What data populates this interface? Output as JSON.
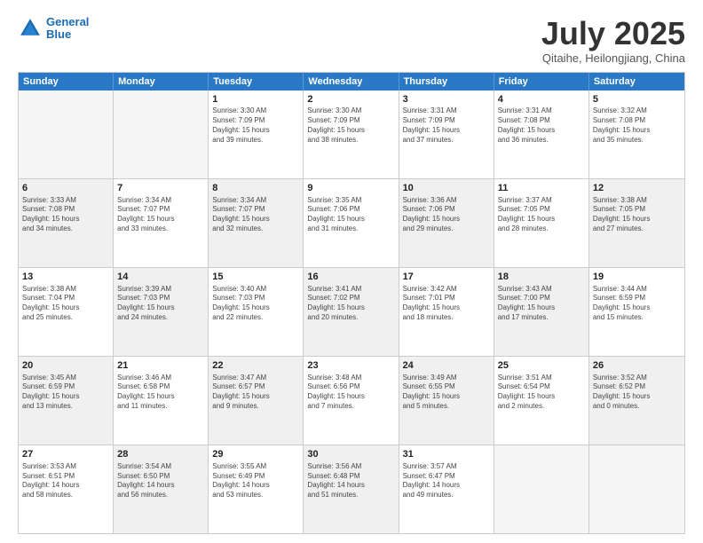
{
  "header": {
    "logo_line1": "General",
    "logo_line2": "Blue",
    "month": "July 2025",
    "location": "Qitaihe, Heilongjiang, China"
  },
  "weekdays": [
    "Sunday",
    "Monday",
    "Tuesday",
    "Wednesday",
    "Thursday",
    "Friday",
    "Saturday"
  ],
  "rows": [
    [
      {
        "day": "",
        "info": "",
        "empty": true
      },
      {
        "day": "",
        "info": "",
        "empty": true
      },
      {
        "day": "1",
        "info": "Sunrise: 3:30 AM\nSunset: 7:09 PM\nDaylight: 15 hours\nand 39 minutes."
      },
      {
        "day": "2",
        "info": "Sunrise: 3:30 AM\nSunset: 7:09 PM\nDaylight: 15 hours\nand 38 minutes."
      },
      {
        "day": "3",
        "info": "Sunrise: 3:31 AM\nSunset: 7:09 PM\nDaylight: 15 hours\nand 37 minutes."
      },
      {
        "day": "4",
        "info": "Sunrise: 3:31 AM\nSunset: 7:08 PM\nDaylight: 15 hours\nand 36 minutes."
      },
      {
        "day": "5",
        "info": "Sunrise: 3:32 AM\nSunset: 7:08 PM\nDaylight: 15 hours\nand 35 minutes."
      }
    ],
    [
      {
        "day": "6",
        "info": "Sunrise: 3:33 AM\nSunset: 7:08 PM\nDaylight: 15 hours\nand 34 minutes.",
        "shaded": true
      },
      {
        "day": "7",
        "info": "Sunrise: 3:34 AM\nSunset: 7:07 PM\nDaylight: 15 hours\nand 33 minutes."
      },
      {
        "day": "8",
        "info": "Sunrise: 3:34 AM\nSunset: 7:07 PM\nDaylight: 15 hours\nand 32 minutes.",
        "shaded": true
      },
      {
        "day": "9",
        "info": "Sunrise: 3:35 AM\nSunset: 7:06 PM\nDaylight: 15 hours\nand 31 minutes."
      },
      {
        "day": "10",
        "info": "Sunrise: 3:36 AM\nSunset: 7:06 PM\nDaylight: 15 hours\nand 29 minutes.",
        "shaded": true
      },
      {
        "day": "11",
        "info": "Sunrise: 3:37 AM\nSunset: 7:05 PM\nDaylight: 15 hours\nand 28 minutes."
      },
      {
        "day": "12",
        "info": "Sunrise: 3:38 AM\nSunset: 7:05 PM\nDaylight: 15 hours\nand 27 minutes.",
        "shaded": true
      }
    ],
    [
      {
        "day": "13",
        "info": "Sunrise: 3:38 AM\nSunset: 7:04 PM\nDaylight: 15 hours\nand 25 minutes."
      },
      {
        "day": "14",
        "info": "Sunrise: 3:39 AM\nSunset: 7:03 PM\nDaylight: 15 hours\nand 24 minutes.",
        "shaded": true
      },
      {
        "day": "15",
        "info": "Sunrise: 3:40 AM\nSunset: 7:03 PM\nDaylight: 15 hours\nand 22 minutes."
      },
      {
        "day": "16",
        "info": "Sunrise: 3:41 AM\nSunset: 7:02 PM\nDaylight: 15 hours\nand 20 minutes.",
        "shaded": true
      },
      {
        "day": "17",
        "info": "Sunrise: 3:42 AM\nSunset: 7:01 PM\nDaylight: 15 hours\nand 18 minutes."
      },
      {
        "day": "18",
        "info": "Sunrise: 3:43 AM\nSunset: 7:00 PM\nDaylight: 15 hours\nand 17 minutes.",
        "shaded": true
      },
      {
        "day": "19",
        "info": "Sunrise: 3:44 AM\nSunset: 6:59 PM\nDaylight: 15 hours\nand 15 minutes."
      }
    ],
    [
      {
        "day": "20",
        "info": "Sunrise: 3:45 AM\nSunset: 6:59 PM\nDaylight: 15 hours\nand 13 minutes.",
        "shaded": true
      },
      {
        "day": "21",
        "info": "Sunrise: 3:46 AM\nSunset: 6:58 PM\nDaylight: 15 hours\nand 11 minutes."
      },
      {
        "day": "22",
        "info": "Sunrise: 3:47 AM\nSunset: 6:57 PM\nDaylight: 15 hours\nand 9 minutes.",
        "shaded": true
      },
      {
        "day": "23",
        "info": "Sunrise: 3:48 AM\nSunset: 6:56 PM\nDaylight: 15 hours\nand 7 minutes."
      },
      {
        "day": "24",
        "info": "Sunrise: 3:49 AM\nSunset: 6:55 PM\nDaylight: 15 hours\nand 5 minutes.",
        "shaded": true
      },
      {
        "day": "25",
        "info": "Sunrise: 3:51 AM\nSunset: 6:54 PM\nDaylight: 15 hours\nand 2 minutes."
      },
      {
        "day": "26",
        "info": "Sunrise: 3:52 AM\nSunset: 6:52 PM\nDaylight: 15 hours\nand 0 minutes.",
        "shaded": true
      }
    ],
    [
      {
        "day": "27",
        "info": "Sunrise: 3:53 AM\nSunset: 6:51 PM\nDaylight: 14 hours\nand 58 minutes."
      },
      {
        "day": "28",
        "info": "Sunrise: 3:54 AM\nSunset: 6:50 PM\nDaylight: 14 hours\nand 56 minutes.",
        "shaded": true
      },
      {
        "day": "29",
        "info": "Sunrise: 3:55 AM\nSunset: 6:49 PM\nDaylight: 14 hours\nand 53 minutes."
      },
      {
        "day": "30",
        "info": "Sunrise: 3:56 AM\nSunset: 6:48 PM\nDaylight: 14 hours\nand 51 minutes.",
        "shaded": true
      },
      {
        "day": "31",
        "info": "Sunrise: 3:57 AM\nSunset: 6:47 PM\nDaylight: 14 hours\nand 49 minutes."
      },
      {
        "day": "",
        "info": "",
        "empty": true
      },
      {
        "day": "",
        "info": "",
        "empty": true
      }
    ]
  ]
}
